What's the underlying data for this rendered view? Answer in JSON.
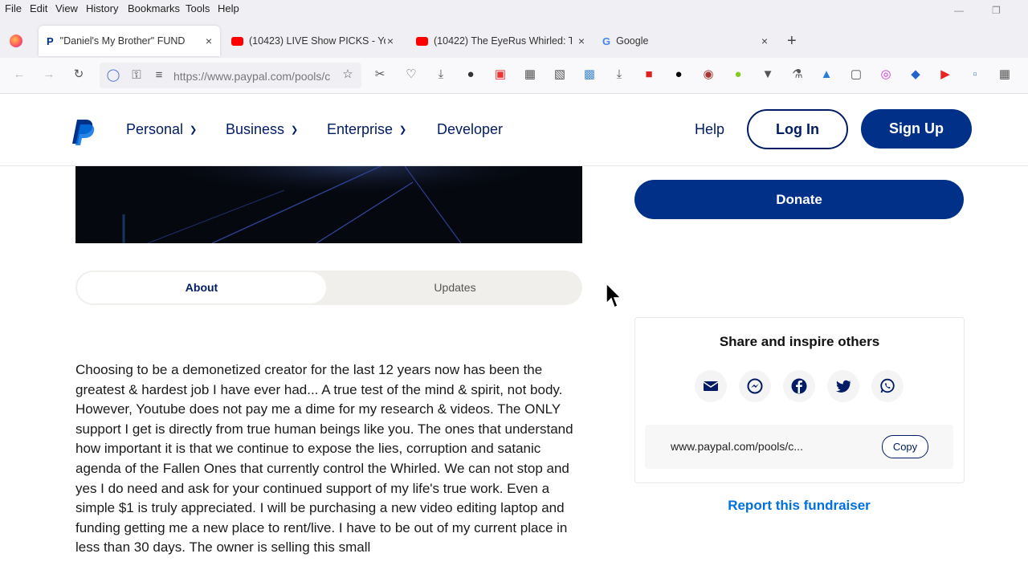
{
  "browser": {
    "menu": [
      "File",
      "Edit",
      "View",
      "History",
      "Bookmarks",
      "Tools",
      "Help"
    ],
    "tabs": [
      {
        "title": "\"Daniel's My Brother\" FUND"
      },
      {
        "title": "(10423) LIVE Show PICKS - YouT"
      },
      {
        "title": "(10422) The EyeRus Whirled: Th"
      },
      {
        "title": "Google"
      }
    ],
    "url": "https://www.paypal.com/pools/c"
  },
  "header": {
    "nav": [
      "Personal",
      "Business",
      "Enterprise",
      "Developer"
    ],
    "help": "Help",
    "login": "Log In",
    "signup": "Sign Up"
  },
  "main": {
    "tabs": [
      "About",
      "Updates"
    ],
    "about_text": "Choosing to be a demonetized creator for the last 12 years now has been the greatest & hardest job I have ever had... A true test of the mind & spirit, not body. However, Youtube does not pay me a dime for my research & videos. The ONLY support I get is directly from true human beings like you. The ones that understand how important it is that we continue to expose the lies, corruption and satanic agenda of the Fallen Ones that currently control the Whirled. We can not stop and yes I do need and ask for your continued support of my life's true work. Even a simple $1 is truly appreciated. I will be purchasing a new video editing laptop and funding getting me a new place to rent/live. I have to be out of my current place in less than 30 days. The owner is selling this small"
  },
  "sidebar": {
    "donate": "Donate",
    "share_title": "Share and inspire others",
    "share_icons": [
      "email-icon",
      "messenger-icon",
      "facebook-icon",
      "twitter-icon",
      "whatsapp-icon"
    ],
    "link": "www.paypal.com/pools/c...",
    "copy": "Copy",
    "report": "Report this fundraiser"
  },
  "colors": {
    "brand": "#003087",
    "link": "#0070e0",
    "nav": "#001c64"
  }
}
